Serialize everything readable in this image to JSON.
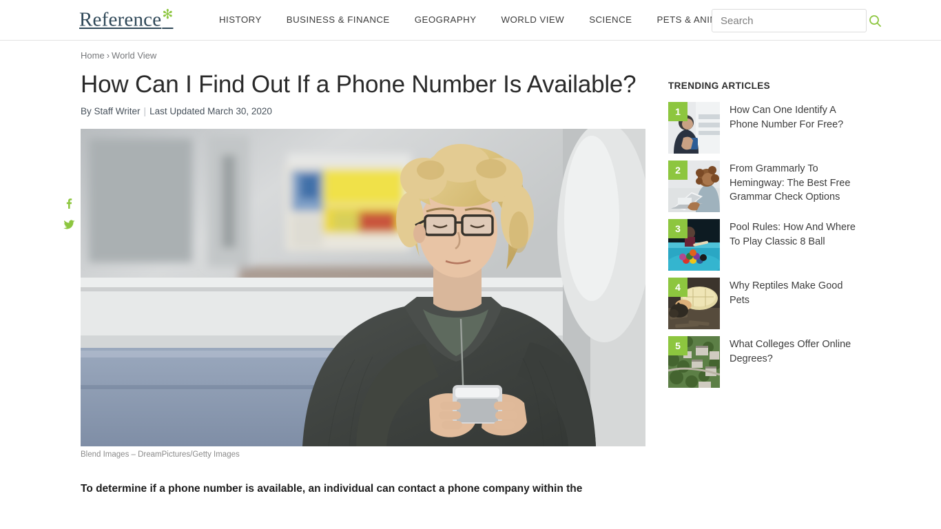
{
  "header": {
    "logo_text": "Reference",
    "logo_star": "✻",
    "nav": [
      {
        "label": "HISTORY"
      },
      {
        "label": "BUSINESS & FINANCE"
      },
      {
        "label": "GEOGRAPHY"
      },
      {
        "label": "WORLD VIEW"
      },
      {
        "label": "SCIENCE"
      },
      {
        "label": "PETS & ANIMALS"
      }
    ],
    "search": {
      "placeholder": "Search",
      "value": "",
      "icon": "search-icon"
    }
  },
  "breadcrumb": {
    "home": "Home",
    "separator": "›",
    "section": "World View"
  },
  "article": {
    "title": "How Can I Find Out If a Phone Number Is Available?",
    "author_prefix": "By ",
    "author": "Staff Writer",
    "divider": "|",
    "updated": "Last Updated March 30, 2020",
    "caption": "Blend Images – DreamPictures/Getty Images",
    "lead_paragraph": "To determine if a phone number is available, an individual can contact a phone company within the"
  },
  "share": [
    {
      "name": "facebook-share-icon",
      "glyph": "f"
    },
    {
      "name": "twitter-share-icon",
      "glyph": "t"
    }
  ],
  "sidebar": {
    "title": "TRENDING ARTICLES",
    "items": [
      {
        "rank": "1",
        "title": "How Can One Identify A Phone Number For Free?"
      },
      {
        "rank": "2",
        "title": "From Grammarly To Hemingway: The Best Free Grammar Check Options"
      },
      {
        "rank": "3",
        "title": "Pool Rules: How And Where To Play Classic 8 Ball"
      },
      {
        "rank": "4",
        "title": "Why Reptiles Make Good Pets"
      },
      {
        "rank": "5",
        "title": "What Colleges Offer Online Degrees?"
      }
    ]
  },
  "colors": {
    "brand_green": "#8dc63f",
    "logo_navy": "#2f4858",
    "text_dark": "#2a2a2a",
    "muted": "#76777a"
  }
}
